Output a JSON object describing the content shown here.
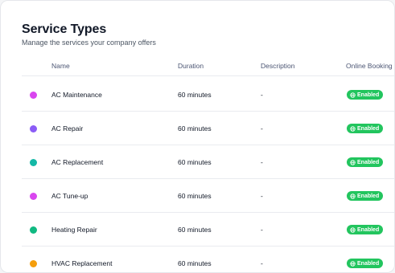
{
  "page": {
    "title": "Service Types",
    "subtitle": "Manage the services your company offers"
  },
  "table": {
    "columns": {
      "name": "Name",
      "duration": "Duration",
      "description": "Description",
      "online_booking": "Online Booking"
    },
    "rows": [
      {
        "color": "#d946ef",
        "name": "AC Maintenance",
        "duration": "60 minutes",
        "description": "-",
        "booking": "Enabled"
      },
      {
        "color": "#8b5cf6",
        "name": "AC Repair",
        "duration": "60 minutes",
        "description": "-",
        "booking": "Enabled"
      },
      {
        "color": "#14b8a6",
        "name": "AC Replacement",
        "duration": "60 minutes",
        "description": "-",
        "booking": "Enabled"
      },
      {
        "color": "#d946ef",
        "name": "AC Tune-up",
        "duration": "60 minutes",
        "description": "-",
        "booking": "Enabled"
      },
      {
        "color": "#10b981",
        "name": "Heating Repair",
        "duration": "60 minutes",
        "description": "-",
        "booking": "Enabled"
      },
      {
        "color": "#f59e0b",
        "name": "HVAC Replacement",
        "duration": "60 minutes",
        "description": "-",
        "booking": "Enabled"
      }
    ]
  },
  "icons": {
    "booking_badge": "globe-icon"
  },
  "colors": {
    "enabled_badge": "#22c55e"
  }
}
